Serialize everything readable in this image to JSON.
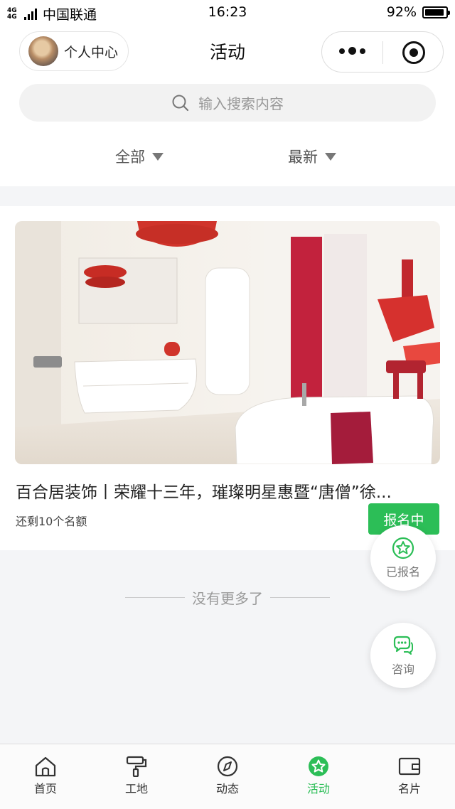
{
  "status_bar": {
    "network_type": "4G 4G",
    "carrier": "中国联通",
    "time": "16:23",
    "battery": "92%",
    "battery_level": 0.92
  },
  "nav": {
    "profile_label": "个人中心",
    "title": "活动"
  },
  "search": {
    "placeholder": "输入搜索内容"
  },
  "filters": [
    {
      "label": "全部"
    },
    {
      "label": "最新"
    }
  ],
  "activity": {
    "title": "百合居装饰丨荣耀十三年，璀璨明星惠暨“唐僧”徐...",
    "quota": "还剩10个名额",
    "status_button": "报名中"
  },
  "list_end": "没有更多了",
  "floating_buttons": {
    "registered": "已报名",
    "consult": "咨询"
  },
  "tabbar": {
    "items": [
      {
        "label": "首页",
        "icon": "home-icon"
      },
      {
        "label": "工地",
        "icon": "paint-roller-icon"
      },
      {
        "label": "动态",
        "icon": "compass-icon"
      },
      {
        "label": "活动",
        "icon": "star-icon",
        "active": true
      },
      {
        "label": "名片",
        "icon": "wallet-icon"
      }
    ]
  },
  "colors": {
    "accent": "#2cbe57",
    "background": "#f4f5f7"
  }
}
